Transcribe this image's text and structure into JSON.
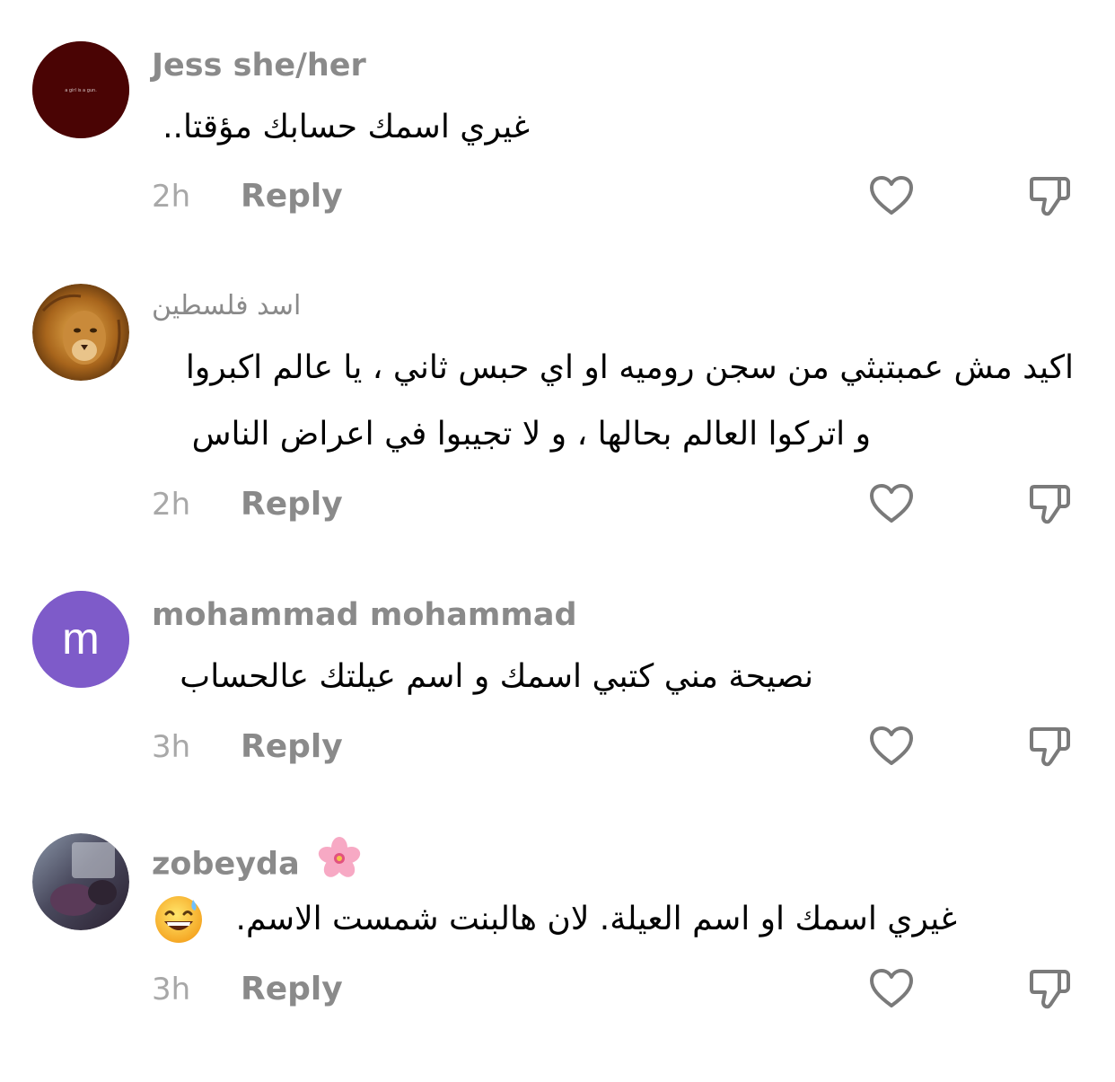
{
  "comments": [
    {
      "username": "Jess she/her",
      "avatar_text": "a girl is a gun.",
      "text": "غيري اسمك حسابك مؤقتا..",
      "time": "2h",
      "reply_label": "Reply"
    },
    {
      "username": "اسد فلسطين",
      "text_line1": "اكيد مش عمبتبثي من سجن روميه او اي حبس ثاني ، يا عالم اكبروا",
      "text_line2": "و اتركوا العالم بحالها ، و لا تجيبوا في اعراض الناس",
      "time": "2h",
      "reply_label": "Reply"
    },
    {
      "username": "mohammad mohammad",
      "avatar_letter": "m",
      "text": "نصيحة مني كتبي اسمك و اسم عيلتك عالحساب",
      "time": "3h",
      "reply_label": "Reply"
    },
    {
      "username": "zobeyda",
      "text": "غيري اسمك او اسم العيلة. لان هالبنت شمست الاسم.",
      "time": "3h",
      "reply_label": "Reply"
    }
  ],
  "icons": {
    "like": "heart-outline-icon",
    "dislike": "thumbs-down-outline-icon",
    "name_emoji": "cherry-blossom-icon",
    "text_emoji": "grinning-sweat-face-icon"
  },
  "colors": {
    "username": "#8a8a8a",
    "time": "#a8a8a8",
    "icon": "#7a7a7a",
    "avatar_jess": "#4a0404",
    "avatar_mohammad": "#7e5bc9"
  }
}
